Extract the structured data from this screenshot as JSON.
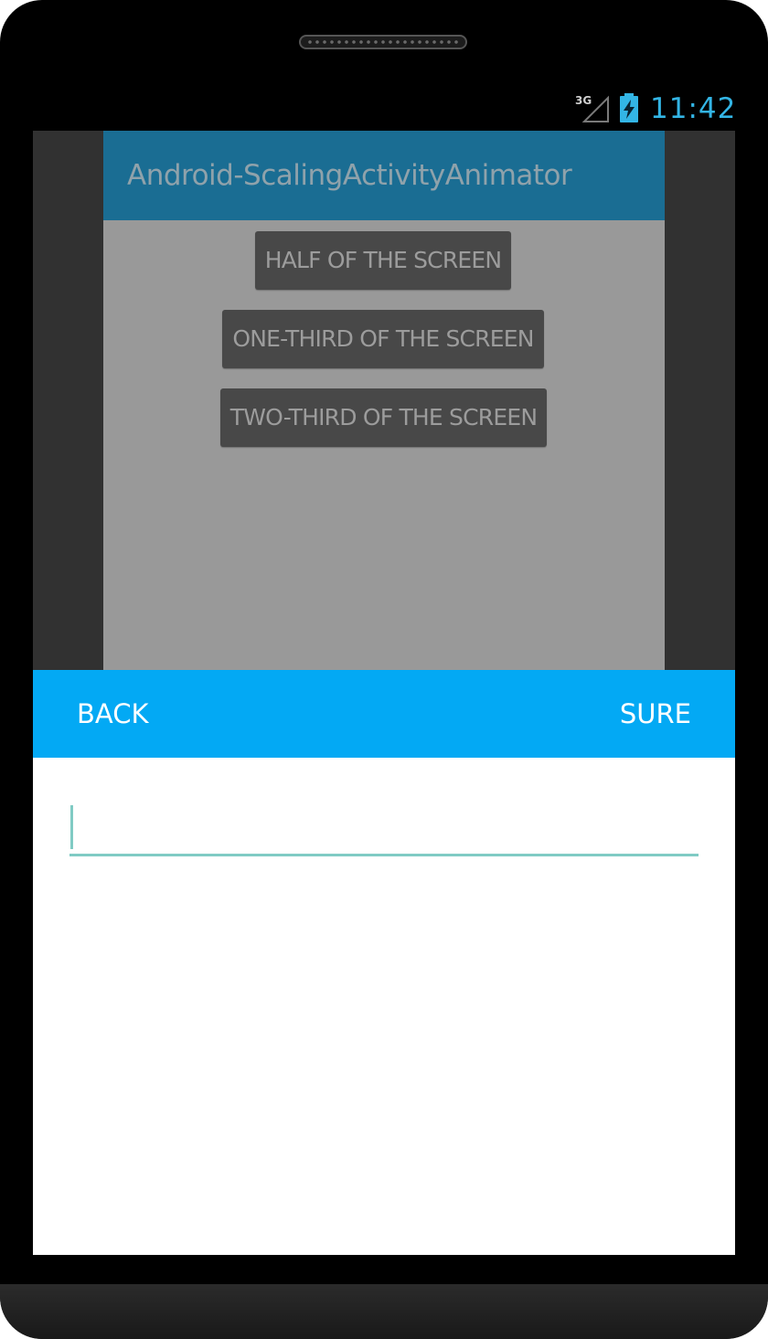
{
  "status_bar": {
    "network_type": "3G",
    "time": "11:42",
    "signal_icon": "signal-3g-icon",
    "battery_icon": "battery-charging-icon",
    "accent_color": "#33b5e5"
  },
  "scaled_activity": {
    "title": "Android-ScalingActivityAnimator",
    "buttons": [
      {
        "label": "HALF OF THE SCREEN"
      },
      {
        "label": "ONE-THIRD OF THE SCREEN"
      },
      {
        "label": "TWO-THIRD OF THE SCREEN"
      }
    ],
    "action_bar_color": "#1a6d93",
    "background_color": "#999999"
  },
  "dialog": {
    "back_label": "BACK",
    "sure_label": "SURE",
    "toolbar_color": "#03a9f4",
    "input": {
      "value": "",
      "placeholder": "",
      "underline_color": "#80cbc4"
    }
  }
}
